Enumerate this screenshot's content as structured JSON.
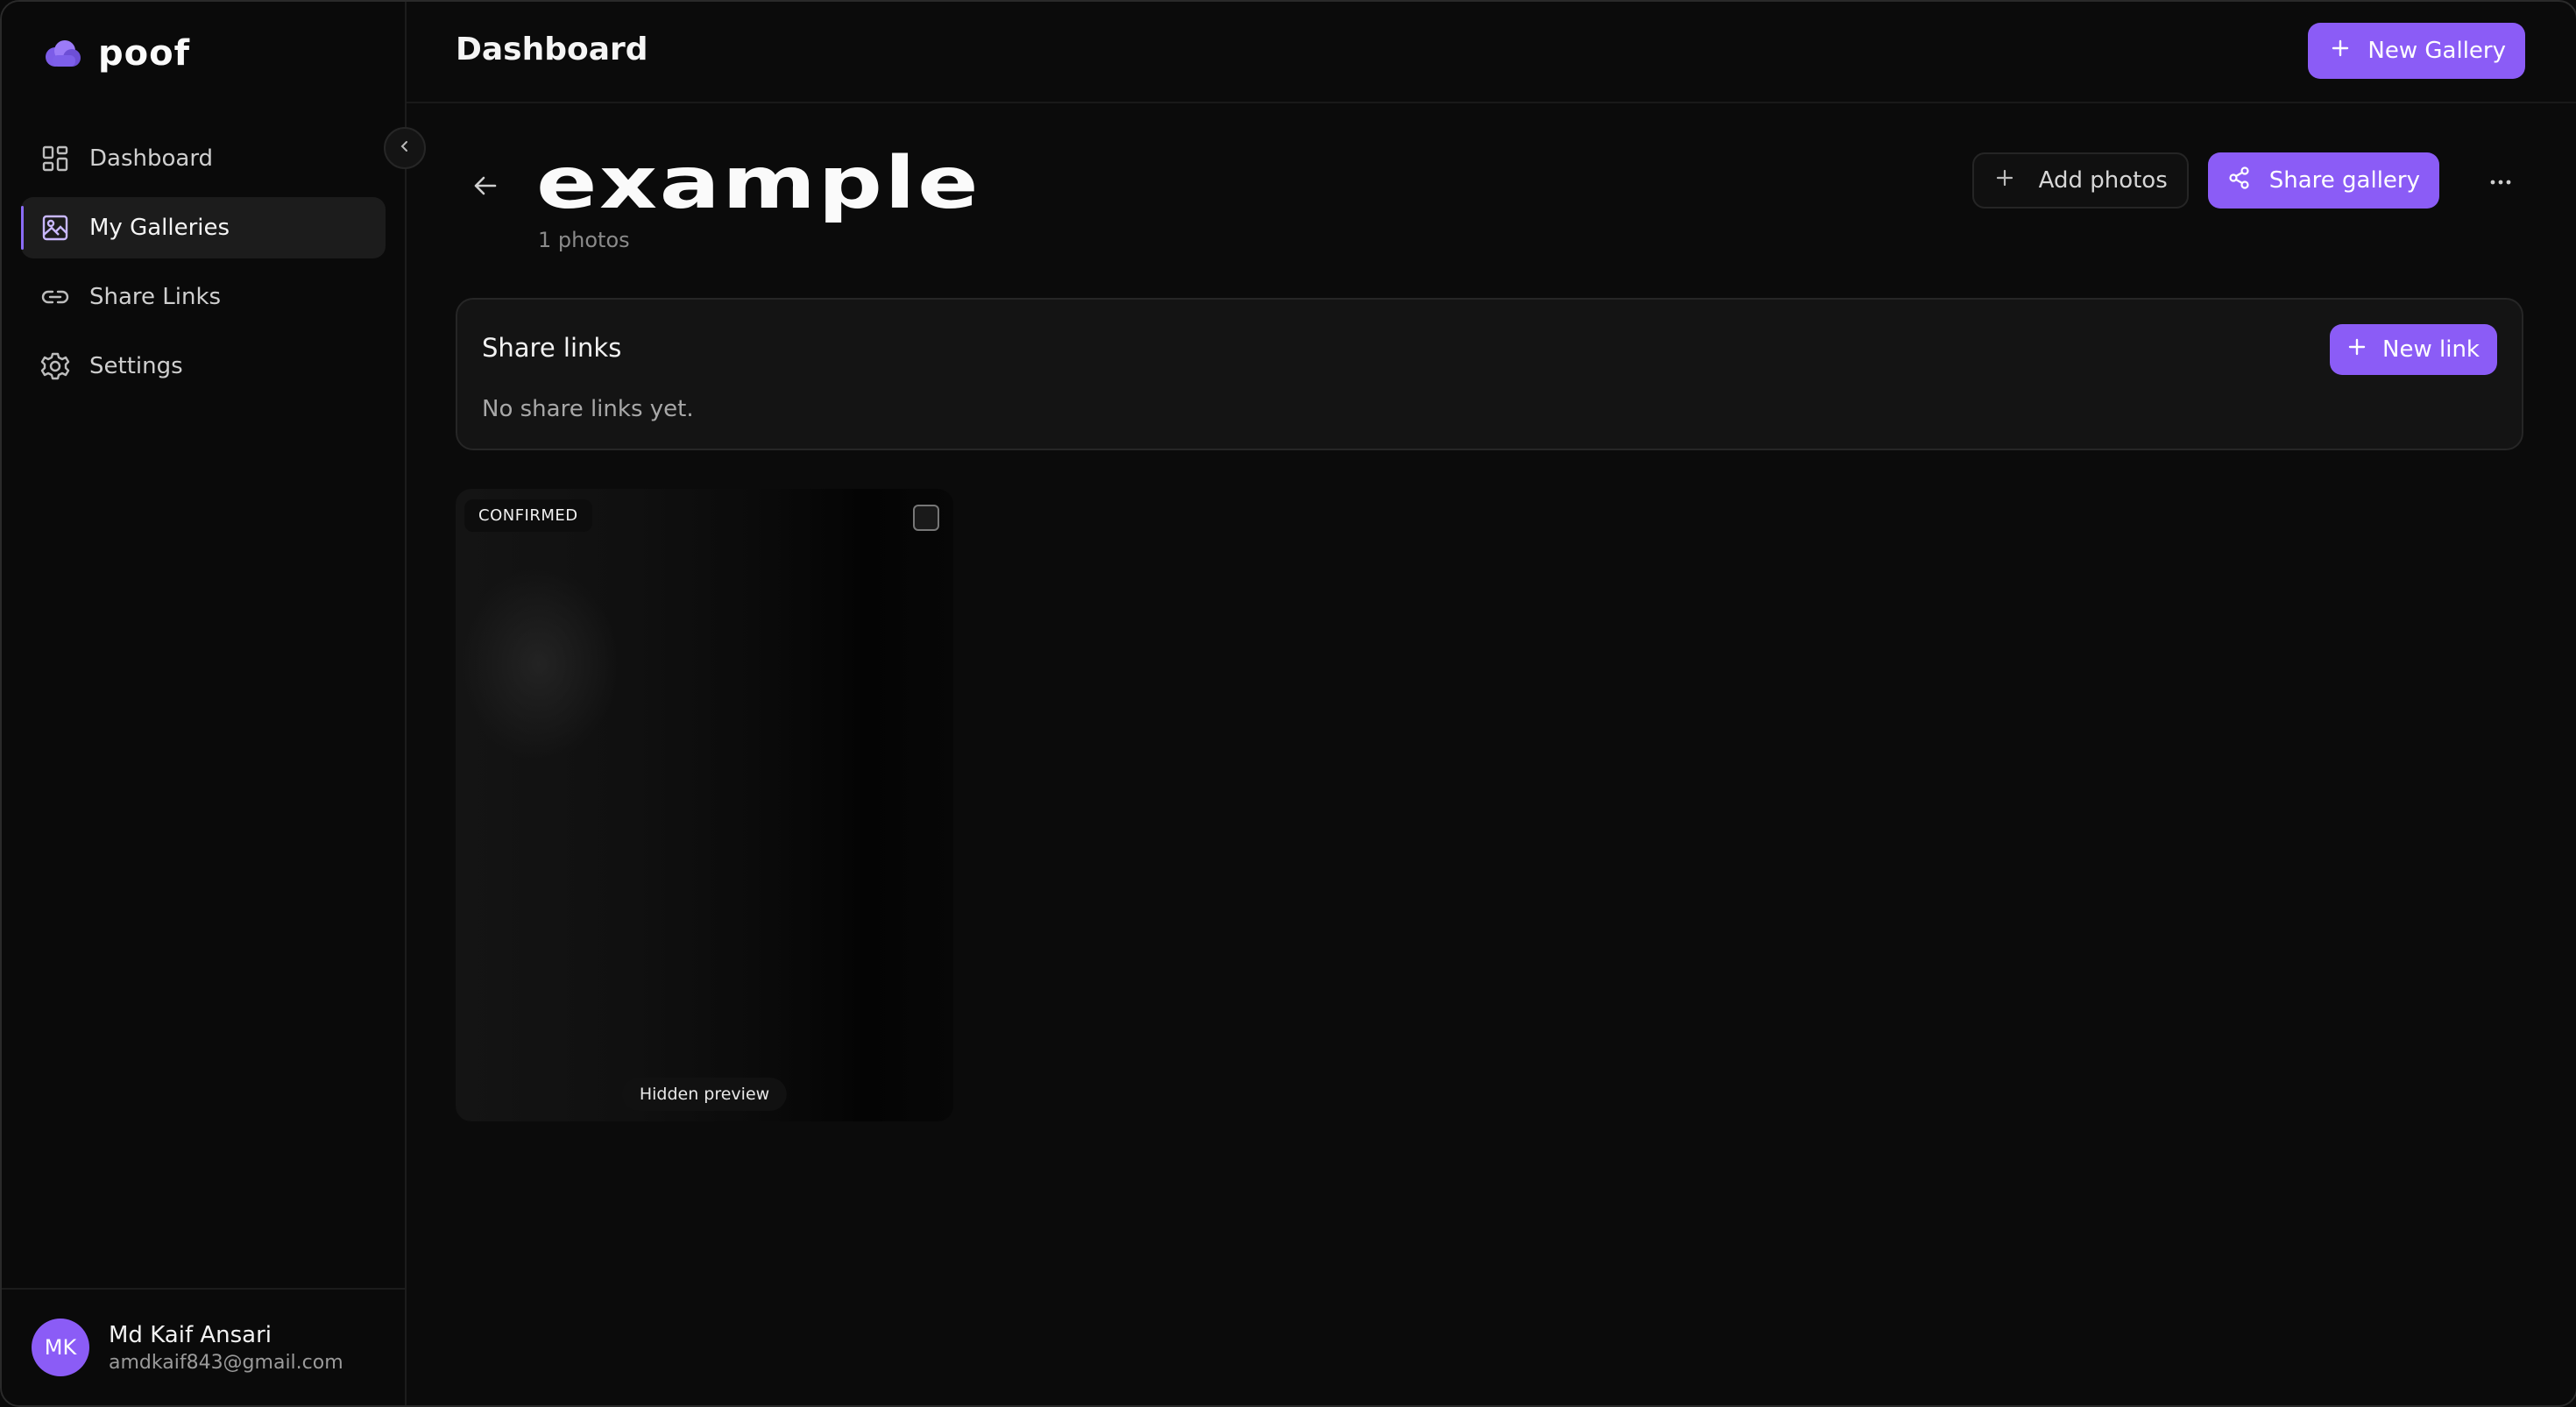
{
  "app": {
    "name": "poof",
    "accent": "#8b5cf6"
  },
  "sidebar": {
    "items": [
      {
        "label": "Dashboard",
        "icon": "dashboard-grid-icon",
        "active": false
      },
      {
        "label": "My Galleries",
        "icon": "image-icon",
        "active": true
      },
      {
        "label": "Share Links",
        "icon": "link-icon",
        "active": false
      },
      {
        "label": "Settings",
        "icon": "gear-icon",
        "active": false
      }
    ],
    "user": {
      "initials": "MK",
      "name": "Md Kaif Ansari",
      "email": "amdkaif843@gmail.com"
    }
  },
  "header": {
    "title": "Dashboard",
    "new_gallery_label": "New Gallery"
  },
  "gallery": {
    "title": "example",
    "photo_count": "1 photos",
    "add_photos_label": "Add photos",
    "share_gallery_label": "Share gallery"
  },
  "share_links": {
    "title": "Share links",
    "empty_text": "No share links yet.",
    "new_link_label": "New link"
  },
  "photos": [
    {
      "badge": "CONFIRMED",
      "caption": "Hidden preview",
      "selected": false
    }
  ]
}
